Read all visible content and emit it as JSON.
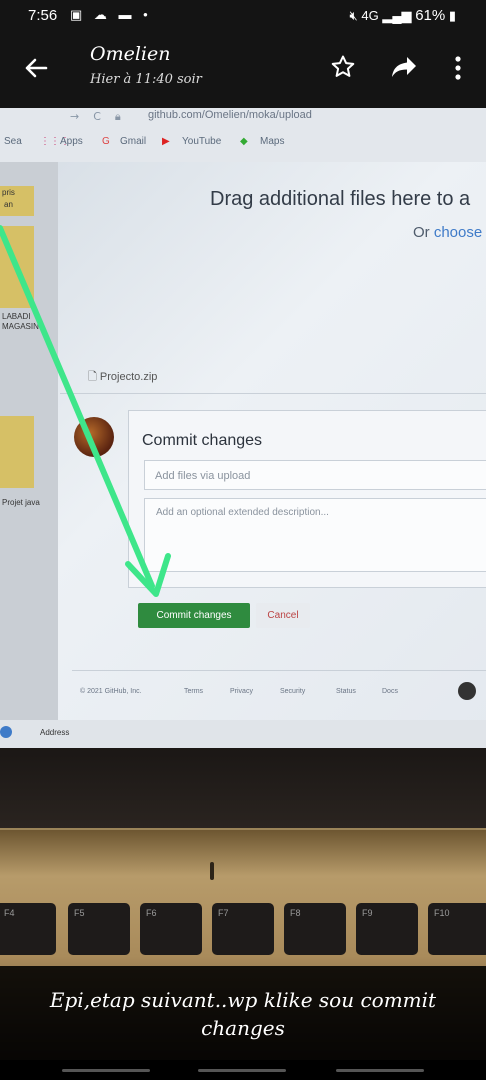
{
  "status_bar": {
    "time": "7:56",
    "left_icons": [
      "image-icon",
      "cloud-icon",
      "message-icon",
      "dot-icon"
    ],
    "right_text": "61%",
    "signal_label": "4G"
  },
  "app_bar": {
    "sender": "Omelien",
    "timestamp": "Hier à 11:40 soir"
  },
  "photo": {
    "browser": {
      "url": "github.com/Omelien/moka/upload",
      "bookmarks": [
        "Apps",
        "Gmail",
        "YouTube",
        "Maps"
      ],
      "search_partial": "Sea"
    },
    "left_panel": {
      "items": [
        "pris",
        "an",
        "LABADI",
        "MAGASIN",
        "Projet java"
      ]
    },
    "upload": {
      "drag_text": "Drag additional files here to a",
      "or_text": "Or ",
      "choose_text": "choose",
      "file_name": "Projecto.zip"
    },
    "commit": {
      "title": "Commit changes",
      "summary_placeholder": "Add files via upload",
      "description_placeholder": "Add an optional extended description...",
      "commit_button": "Commit changes",
      "cancel_button": "Cancel"
    },
    "footer": {
      "copyright": "© 2021 GitHub, Inc.",
      "links": [
        "Terms",
        "Privacy",
        "Security",
        "Status",
        "Docs"
      ]
    },
    "taskbar": {
      "address_label": "Address"
    },
    "keyboard": {
      "keys": [
        "F4",
        "F5",
        "F6",
        "F7",
        "F8",
        "F9",
        "F10"
      ]
    },
    "annotation_color": "#3ee68a"
  },
  "caption": {
    "text": "Epi,etap suivant..wp klike sou commit changes"
  }
}
